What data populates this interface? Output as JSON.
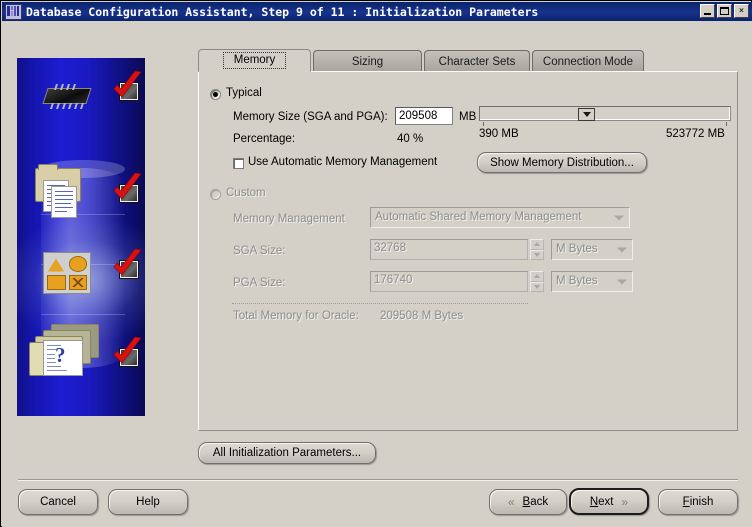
{
  "window": {
    "title": "Database Configuration Assistant, Step 9 of 11 : Initialization Parameters",
    "icon": "database-icon",
    "minimize_label": "",
    "maximize_label": "",
    "close_label": "×"
  },
  "tabs": [
    {
      "label": "Memory",
      "selected": true
    },
    {
      "label": "Sizing",
      "selected": false
    },
    {
      "label": "Character Sets",
      "selected": false
    },
    {
      "label": "Connection Mode",
      "selected": false
    }
  ],
  "typical": {
    "radio_label": "Typical",
    "selected": true,
    "memory_size_label": "Memory Size (SGA and PGA):",
    "memory_size_value": "209508",
    "memory_size_unit": "MB",
    "percentage_label": "Percentage:",
    "percentage_value": "40 %",
    "slider_min_label": "390 MB",
    "slider_max_label": "523772 MB",
    "slider_position_percent": 42,
    "auto_memory_label": "Use Automatic Memory Management",
    "auto_memory_checked": false,
    "show_distribution_label": "Show Memory Distribution..."
  },
  "custom": {
    "radio_label": "Custom",
    "selected": false,
    "memory_management_label": "Memory Management",
    "memory_management_value": "Automatic Shared Memory Management",
    "sga_label": "SGA Size:",
    "sga_value": "32768",
    "sga_unit": "M Bytes",
    "pga_label": "PGA Size:",
    "pga_value": "176740",
    "pga_unit": "M Bytes",
    "total_label": "Total Memory for Oracle:",
    "total_value": "209508 M Bytes"
  },
  "footer": {
    "all_params_label": "All Initialization Parameters...",
    "cancel_label": "Cancel",
    "help_label": "Help",
    "back_label": "Back",
    "next_label": "Next",
    "finish_label": "Finish",
    "back_chevron": "«",
    "next_chevron": "»"
  },
  "illustration": {
    "steps": [
      {
        "icon": "memory-chip-icon",
        "checked": true
      },
      {
        "icon": "documents-folder-icon",
        "checked": true
      },
      {
        "icon": "options-panel-icon",
        "checked": true
      },
      {
        "icon": "folders-question-icon",
        "checked": true
      }
    ]
  },
  "colors": {
    "titlebar": "#0a246a",
    "face": "#d4d0c8",
    "illustration_blue": "#1d1dd2",
    "check_red": "#d81111"
  }
}
